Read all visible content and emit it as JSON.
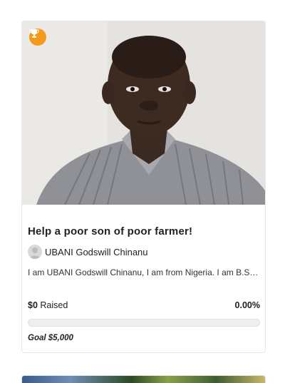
{
  "campaign": {
    "title": "Help a poor son of poor farmer!",
    "owner_name": "UBANI Godswill Chinanu",
    "description": "I am UBANI Godswill Chinanu, I am from Nigeria. I am B.S…",
    "raised_amount": "$0",
    "raised_label": "Raised",
    "percent_text": "0.00%",
    "progress_fraction": 0.0,
    "goal_text": "Goal $5,000"
  },
  "colors": {
    "trophy_badge": "#f39a1e",
    "progress_track": "#eeeeee"
  },
  "icons": {
    "badge": "trophy-icon",
    "avatar": "user-avatar-icon"
  }
}
